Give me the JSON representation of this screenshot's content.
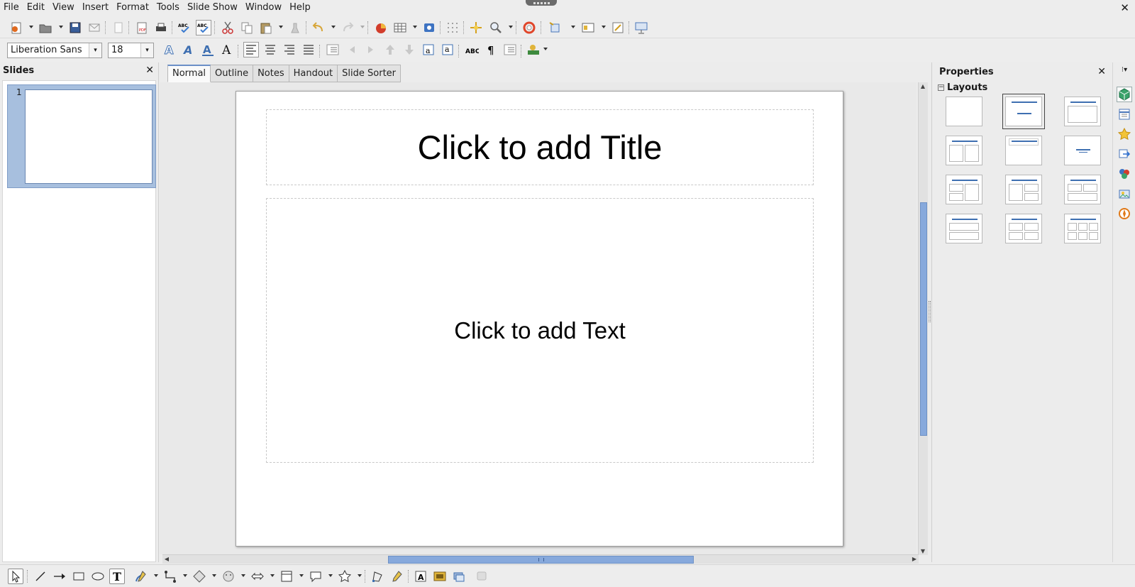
{
  "menu": [
    "File",
    "Edit",
    "View",
    "Insert",
    "Format",
    "Tools",
    "Slide Show",
    "Window",
    "Help"
  ],
  "font": {
    "name": "Liberation Sans",
    "size": "18"
  },
  "slides_pane": {
    "title": "Slides",
    "slide_number": "1"
  },
  "view_tabs": [
    "Normal",
    "Outline",
    "Notes",
    "Handout",
    "Slide Sorter"
  ],
  "slide": {
    "title_placeholder": "Click to add Title",
    "text_placeholder": "Click to add Text"
  },
  "properties": {
    "title": "Properties",
    "section": "Layouts",
    "collapse_symbol": "−"
  },
  "colors": {
    "accent": "#87a9dc",
    "selection": "#a7bfde",
    "layout_title": "#3e6fb1"
  }
}
